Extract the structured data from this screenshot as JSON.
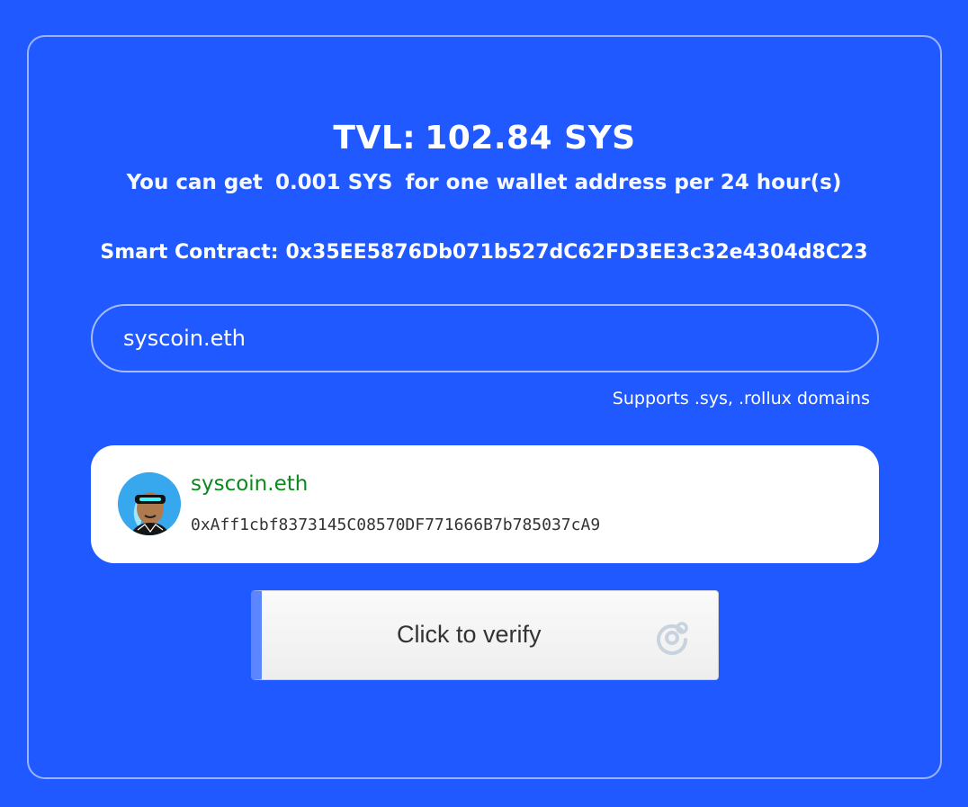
{
  "tvl": {
    "label": "TVL:",
    "value": "102.84 SYS"
  },
  "info": {
    "prefix": "You can get",
    "amount": "0.001 SYS",
    "suffix": "for one wallet address per 24 hour(s)"
  },
  "contract": {
    "label": "Smart Contract:",
    "address": "0x35EE5876Db071b527dC62FD3EE3c32e4304d8C23"
  },
  "domain_input": {
    "value": "syscoin.eth"
  },
  "hint": "Supports .sys, .rollux domains",
  "result": {
    "name": "syscoin.eth",
    "address": "0xAff1cbf8373145C08570DF771666B7b785037cA9",
    "avatar_icon": "avatar-icon"
  },
  "verify": {
    "label": "Click to verify",
    "icon": "captcha-icon"
  },
  "colors": {
    "background": "#2059ff",
    "name_green": "#0a8a1a",
    "verify_accent": "#5b86ff"
  }
}
